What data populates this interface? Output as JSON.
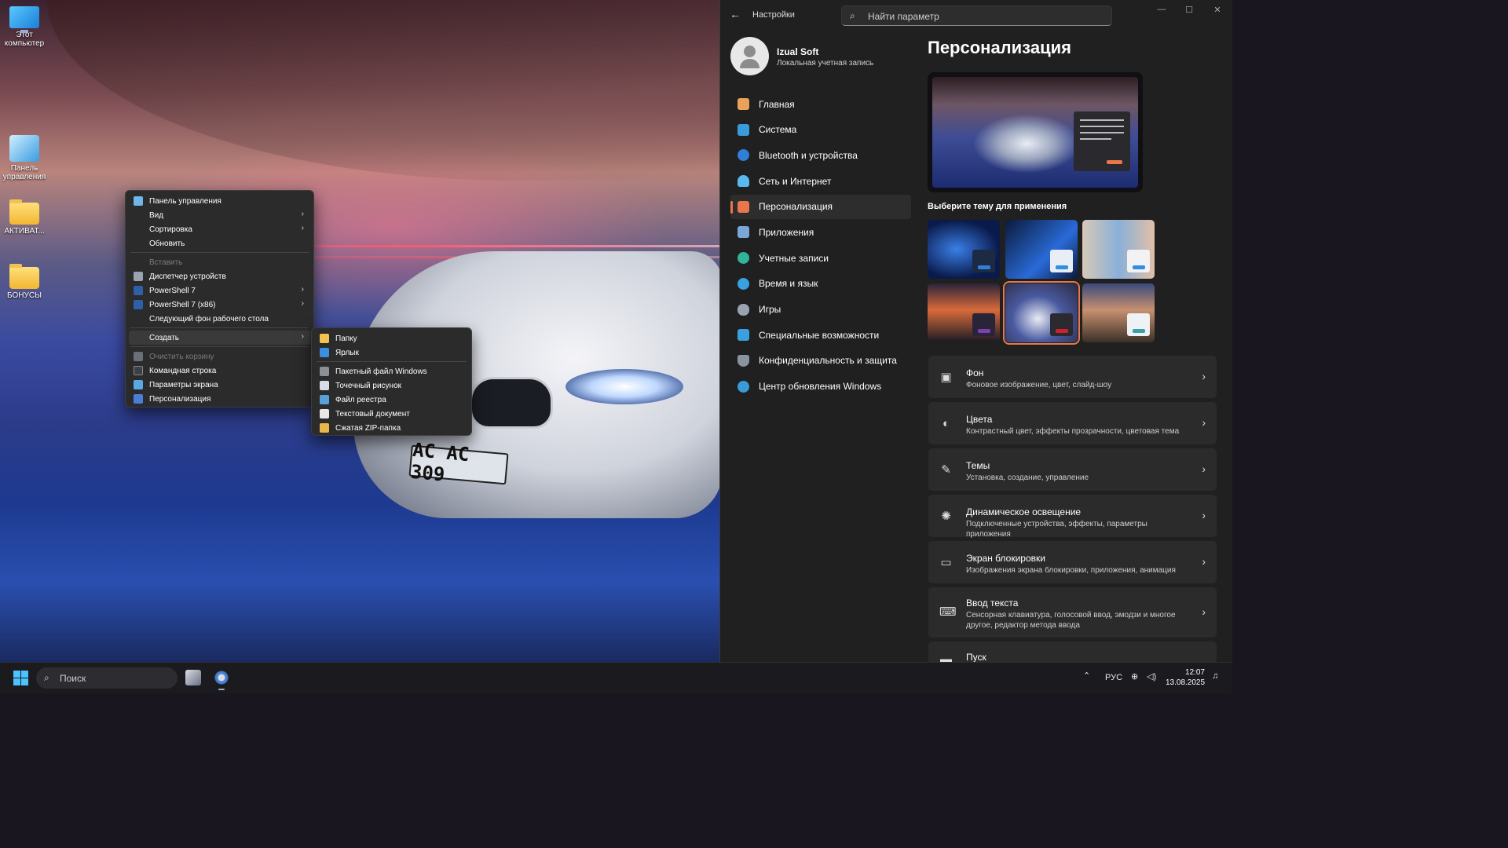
{
  "desktop": {
    "icons": [
      {
        "label": "Этот компьютер",
        "icon": "computer-icon"
      },
      {
        "label": "Панель управления",
        "icon": "control-panel-icon"
      },
      {
        "label": "АКТИВАТ...",
        "icon": "folder-icon"
      },
      {
        "label": "БОНУСЫ",
        "icon": "folder-icon"
      }
    ],
    "plate_text": "AC AC 309"
  },
  "context_menu": {
    "items": [
      {
        "label": "Панель управления",
        "icon": "control-panel-icon"
      },
      {
        "label": "Вид",
        "submenu": true
      },
      {
        "label": "Сортировка",
        "submenu": true
      },
      {
        "label": "Обновить"
      },
      {
        "label": "Вставить",
        "disabled": true
      },
      {
        "label": "Диспетчер устройств",
        "icon": "device-manager-icon"
      },
      {
        "label": "PowerShell 7",
        "icon": "powershell-icon",
        "submenu": true
      },
      {
        "label": "PowerShell 7 (x86)",
        "icon": "powershell-icon",
        "submenu": true
      },
      {
        "label": "Следующий фон рабочего стола"
      },
      {
        "label": "Создать",
        "submenu": true,
        "active": true
      },
      {
        "label": "Очистить корзину",
        "icon": "recycle-bin-icon",
        "disabled": true
      },
      {
        "label": "Командная строка",
        "icon": "command-prompt-icon"
      },
      {
        "label": "Параметры экрана",
        "icon": "display-settings-icon"
      },
      {
        "label": "Персонализация",
        "icon": "personalization-icon"
      }
    ]
  },
  "submenu_create": {
    "items": [
      {
        "label": "Папку",
        "icon": "folder-icon"
      },
      {
        "label": "Ярлык",
        "icon": "shortcut-icon"
      },
      {
        "label": "Пакетный файл Windows",
        "icon": "batch-file-icon"
      },
      {
        "label": "Точечный рисунок",
        "icon": "bitmap-icon"
      },
      {
        "label": "Файл реестра",
        "icon": "registry-file-icon"
      },
      {
        "label": "Текстовый документ",
        "icon": "text-document-icon"
      },
      {
        "label": "Сжатая ZIP-папка",
        "icon": "zip-folder-icon"
      }
    ]
  },
  "settings": {
    "app_title": "Настройки",
    "search_placeholder": "Найти параметр",
    "user": {
      "name": "Izual Soft",
      "account_type": "Локальная учетная запись"
    },
    "nav": [
      {
        "label": "Главная",
        "icon": "home-icon",
        "color": "#e8a25a"
      },
      {
        "label": "Система",
        "icon": "system-icon",
        "color": "#3a9bdc"
      },
      {
        "label": "Bluetooth и устройства",
        "icon": "bluetooth-icon",
        "color": "#2f7fd8"
      },
      {
        "label": "Сеть и Интернет",
        "icon": "network-icon",
        "color": "#5ab8f0"
      },
      {
        "label": "Персонализация",
        "icon": "brush-icon",
        "color": "#e8774c",
        "selected": true
      },
      {
        "label": "Приложения",
        "icon": "apps-icon",
        "color": "#7aa7d8"
      },
      {
        "label": "Учетные записи",
        "icon": "accounts-icon",
        "color": "#2fb59a"
      },
      {
        "label": "Время и язык",
        "icon": "time-language-icon",
        "color": "#3aa0e0"
      },
      {
        "label": "Игры",
        "icon": "gamepad-icon",
        "color": "#9aa3b0"
      },
      {
        "label": "Специальные возможности",
        "icon": "accessibility-icon",
        "color": "#3aa0e0"
      },
      {
        "label": "Конфиденциальность и защита",
        "icon": "shield-icon",
        "color": "#8a93a0"
      },
      {
        "label": "Центр обновления Windows",
        "icon": "update-icon",
        "color": "#3a9bdc"
      }
    ],
    "page_title": "Персонализация",
    "theme_label": "Выберите тему для применения",
    "themes": [
      {
        "name": "bloom-blue",
        "accent": "#2f7fd8"
      },
      {
        "name": "windows-blue",
        "accent": "#2f8fe0"
      },
      {
        "name": "glow",
        "accent": "#2f8fe0"
      },
      {
        "name": "sunset",
        "accent": "#7b3fb0"
      },
      {
        "name": "car",
        "accent": "#d02030",
        "selected": true
      },
      {
        "name": "coast",
        "accent": "#3aa0a8"
      }
    ],
    "cards": [
      {
        "title": "Фон",
        "subtitle": "Фоновое изображение, цвет, слайд-шоу",
        "icon": "image-icon"
      },
      {
        "title": "Цвета",
        "subtitle": "Контрастный цвет, эффекты прозрачности, цветовая тема",
        "icon": "palette-icon"
      },
      {
        "title": "Темы",
        "subtitle": "Установка, создание, управление",
        "icon": "brush-icon"
      },
      {
        "title": "Динамическое освещение",
        "subtitle": "Подключенные устройства, эффекты, параметры приложения",
        "icon": "lighting-icon"
      },
      {
        "title": "Экран блокировки",
        "subtitle": "Изображения экрана блокировки, приложения, анимация",
        "icon": "lock-screen-icon"
      },
      {
        "title": "Ввод текста",
        "subtitle": "Сенсорная клавиатура, голосовой ввод, эмодзи и многое другое, редактор метода ввода",
        "icon": "keyboard-icon"
      },
      {
        "title": "Пуск",
        "subtitle": "",
        "icon": "start-icon"
      }
    ]
  },
  "taskbar": {
    "search_placeholder": "Поиск",
    "language": "РУС",
    "time": "12:07",
    "date": "13.08.2025"
  },
  "colors": {
    "accent": "#e8774c",
    "panel": "#202020",
    "card": "#2b2b2b"
  }
}
